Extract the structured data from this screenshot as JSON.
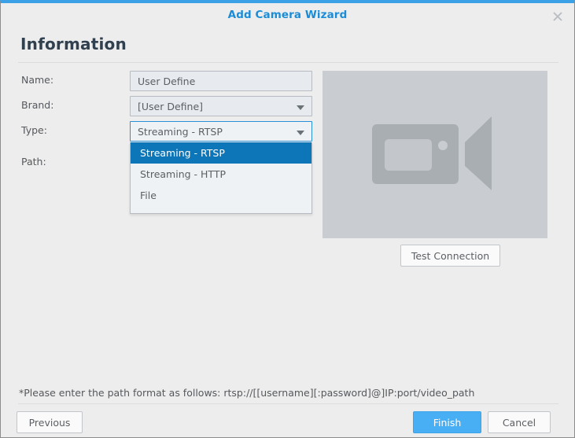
{
  "window": {
    "title": "Add Camera Wizard",
    "close_icon": "close-icon",
    "accent_color": "#3ba0e6",
    "title_color": "#1a8cd8"
  },
  "page": {
    "heading": "Information"
  },
  "form": {
    "fields": [
      {
        "label": "Name:",
        "value": "User Define",
        "type": "text"
      },
      {
        "label": "Brand:",
        "value": "[User Define]",
        "type": "select"
      },
      {
        "label": "Type:",
        "value": "Streaming - RTSP",
        "type": "select"
      },
      {
        "label": "Path:",
        "value": "",
        "type": "text"
      }
    ]
  },
  "type_dropdown": {
    "open": true,
    "selected": "Streaming - RTSP",
    "highlight_color": "#0c76b8",
    "options": [
      "Streaming - RTSP",
      "Streaming - HTTP",
      "File"
    ]
  },
  "preview": {
    "icon": "video-camera-icon",
    "background_color": "#c9cdd2",
    "test_button": "Test Connection"
  },
  "footer": {
    "note": "*Please enter the path format as follows: rtsp://[[username][:password]@]IP:port/video_path",
    "previous_label": "Previous",
    "finish_label": "Finish",
    "cancel_label": "Cancel",
    "primary_color": "#49aff5"
  }
}
